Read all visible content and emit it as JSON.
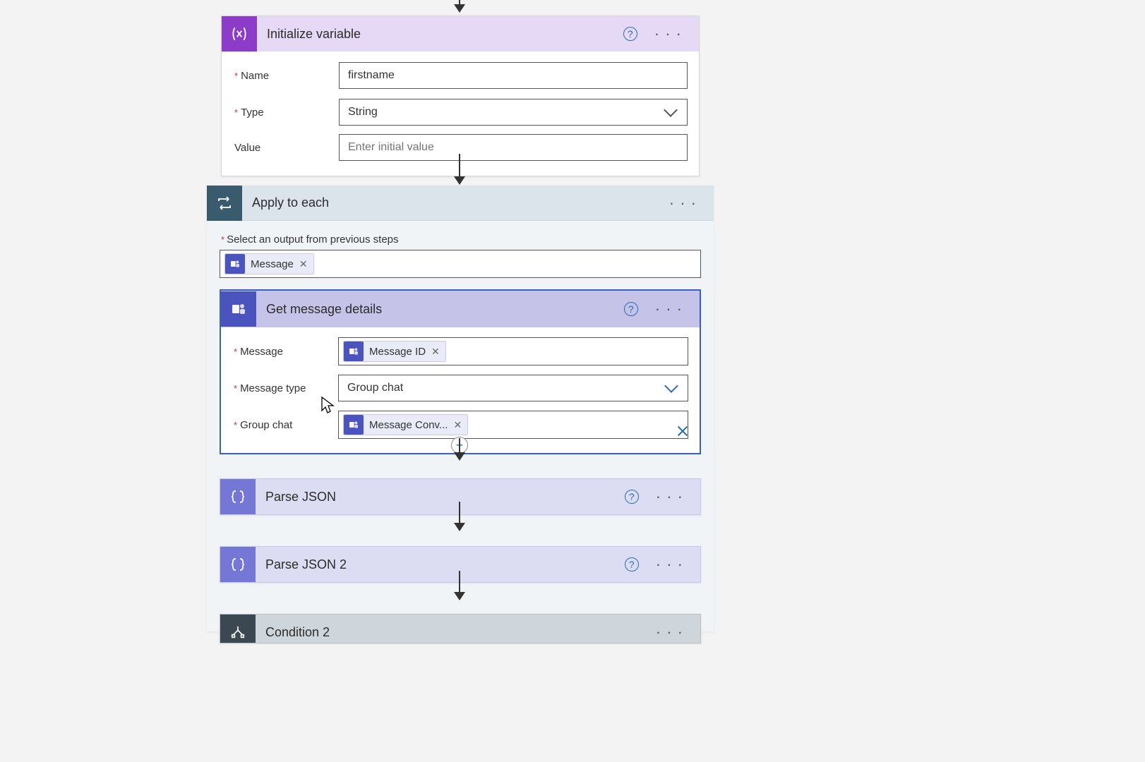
{
  "init_var": {
    "title": "Initialize variable",
    "fields": {
      "name_label": "Name",
      "name_value": "firstname",
      "type_label": "Type",
      "type_value": "String",
      "value_label": "Value",
      "value_placeholder": "Enter initial value"
    }
  },
  "apply_each": {
    "title": "Apply to each",
    "select_label": "Select an output from previous steps",
    "token": "Message"
  },
  "get_msg": {
    "title": "Get message details",
    "fields": {
      "message_label": "Message",
      "message_token": "Message ID",
      "msgtype_label": "Message type",
      "msgtype_value": "Group chat",
      "groupchat_label": "Group chat",
      "groupchat_token": "Message Conv..."
    }
  },
  "parse1": {
    "title": "Parse JSON"
  },
  "parse2": {
    "title": "Parse JSON 2"
  },
  "cond2": {
    "title": "Condition 2"
  }
}
